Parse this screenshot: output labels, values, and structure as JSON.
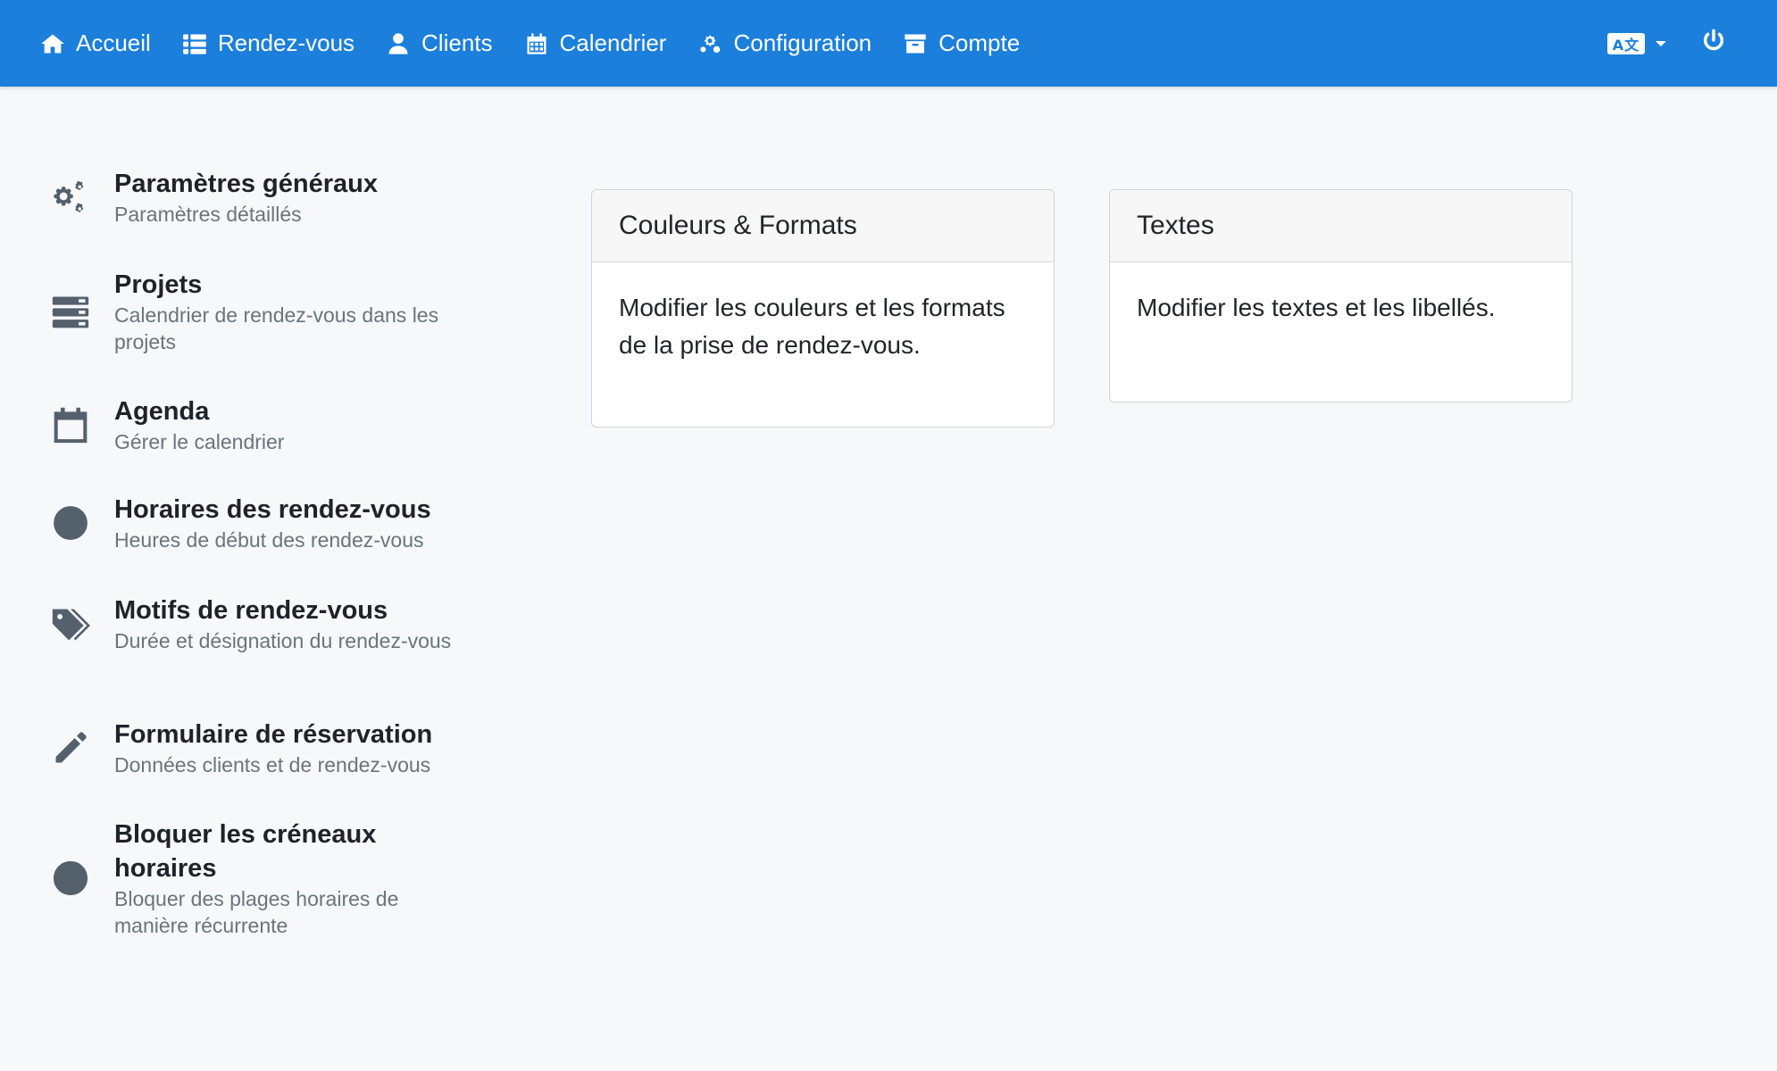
{
  "navbar": {
    "items": [
      {
        "label": "Accueil",
        "icon": "home-icon"
      },
      {
        "label": "Rendez-vous",
        "icon": "list-icon"
      },
      {
        "label": "Clients",
        "icon": "user-icon"
      },
      {
        "label": "Calendrier",
        "icon": "calendar-icon"
      },
      {
        "label": "Configuration",
        "icon": "cogs-icon"
      },
      {
        "label": "Compte",
        "icon": "archive-icon"
      }
    ],
    "language_icon": "language-icon",
    "language_glyph": "A文",
    "power_icon": "power-icon",
    "colors": {
      "background": "#1b7fdb",
      "text": "#ffffff"
    }
  },
  "sidebar": {
    "items": [
      {
        "title": "Paramètres généraux",
        "subtitle": "Paramètres détaillés",
        "icon": "cogs-icon"
      },
      {
        "title": "Projets",
        "subtitle": "Calendrier de rendez-vous dans les projets",
        "icon": "server-icon"
      },
      {
        "title": "Agenda",
        "subtitle": "Gérer le calendrier",
        "icon": "calendar-icon"
      },
      {
        "title": "Horaires des rendez-vous",
        "subtitle": "Heures de début des rendez-vous",
        "icon": "clock-icon"
      },
      {
        "title": "Motifs de rendez-vous",
        "subtitle": "Durée et désignation du rendez-vous",
        "icon": "tags-icon"
      },
      {
        "title": "Formulaire de réservation",
        "subtitle": "Données clients et de rendez-vous",
        "icon": "pencil-icon"
      },
      {
        "title": "Bloquer les créneaux horaires",
        "subtitle": "Bloquer des plages horaires de manière récurrente",
        "icon": "ban-icon"
      }
    ]
  },
  "cards": [
    {
      "title": "Couleurs & Formats",
      "body": "Modifier les couleurs et les formats de la prise de rendez-vous."
    },
    {
      "title": "Textes",
      "body": "Modifier les textes et les libellés."
    }
  ]
}
